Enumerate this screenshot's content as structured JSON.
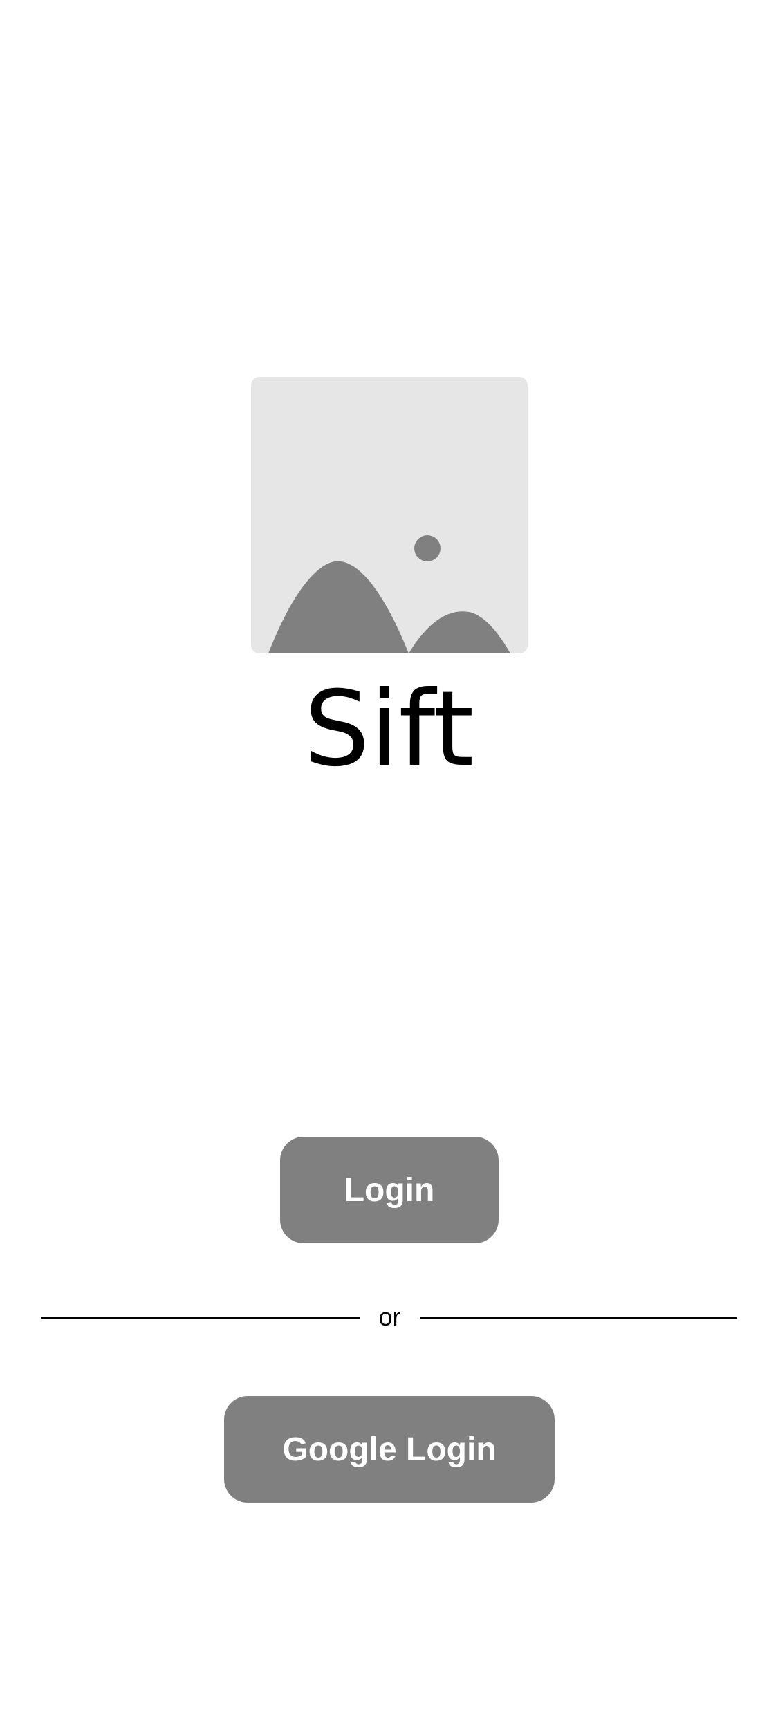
{
  "logo": {
    "icon": "image-placeholder-icon",
    "background_color": "#e6e6e6",
    "shape_color": "#808080"
  },
  "app": {
    "title": "Sift"
  },
  "actions": {
    "login_label": "Login",
    "divider_label": "or",
    "google_login_label": "Google Login"
  },
  "colors": {
    "button_background": "#808080",
    "button_text": "#ffffff",
    "page_background": "#ffffff"
  }
}
